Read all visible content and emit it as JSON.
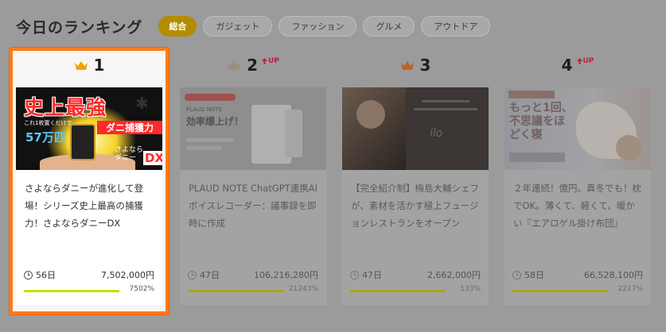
{
  "header": {
    "title": "今日のランキング",
    "tabs": [
      {
        "label": "総合",
        "active": true
      },
      {
        "label": "ガジェット",
        "active": false
      },
      {
        "label": "ファッション",
        "active": false
      },
      {
        "label": "グルメ",
        "active": false
      },
      {
        "label": "アウトドア",
        "active": false
      }
    ]
  },
  "colors": {
    "accent_tab": "#b38c00",
    "highlight_border": "#ff7b16",
    "progress_fill": "#c8e000",
    "up_arrow": "#b8233d",
    "crown_gold": "#f2a400",
    "crown_silver": "#9a8f7a",
    "crown_bronze": "#c0622a"
  },
  "cards": [
    {
      "rank": "1",
      "up_label": "",
      "crown": "crown-gold-icon",
      "thumb": {
        "headline": "史上最強",
        "sub_small": "これ1枚置くだけで",
        "count": "57万匹",
        "banner": "ダニ捕獲力",
        "brand_line1": "さよなら",
        "brand_line2": "ダニー",
        "brand_tag": "DX"
      },
      "title": "さよならダニーが進化して登場！シリーズ史上最高の捕獲力！さよならダニーDX",
      "days": "56日",
      "amount": "7,502,000円",
      "progress_percent": 100,
      "percent_label": "7502%"
    },
    {
      "rank": "2",
      "up_label": "UP",
      "crown": "crown-silver-icon",
      "thumb": {
        "line1": "PLAUD NOTE",
        "line2": "効率爆上げ！"
      },
      "title": "PLAUD NOTE ChatGPT連携AIボイスレコーダー：議事録を即時に作成",
      "days": "47日",
      "amount": "106,216,280円",
      "progress_percent": 100,
      "percent_label": "21243%"
    },
    {
      "rank": "3",
      "up_label": "",
      "crown": "crown-bronze-icon",
      "thumb": {
        "signature": "ilo"
      },
      "title": "【完全紹介制】梅島大輔シェフが、素材を活かす極上フュージョンレストランをオープン",
      "days": "47日",
      "amount": "2,662,000円",
      "progress_percent": 100,
      "percent_label": "133%"
    },
    {
      "rank": "4",
      "up_label": "UP",
      "crown": "crown-bronze-icon",
      "thumb": {
        "headline": "もっと1回、不思議をほどく寝",
        "badge": "",
        "bar": ""
      },
      "title": "２年連続！億円。真冬でも！枕でOK。薄くて、軽くて、暖かい『エアロゲル掛け布団』",
      "days": "58日",
      "amount": "66,528,100円",
      "progress_percent": 100,
      "percent_label": "2217%"
    }
  ]
}
